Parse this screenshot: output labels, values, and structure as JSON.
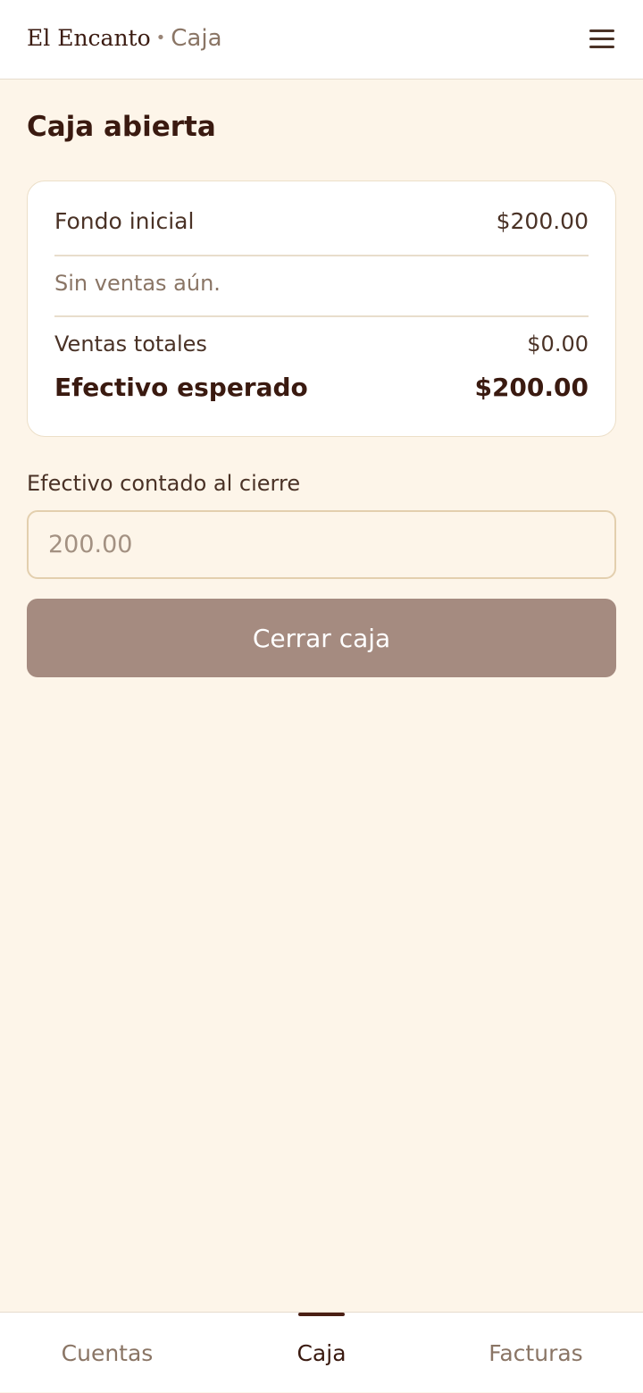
{
  "header": {
    "brand": "El Encanto",
    "separator": "•",
    "section": "Caja",
    "menu_icon": "hamburger-menu-icon"
  },
  "page": {
    "title": "Caja abierta"
  },
  "summary": {
    "opening_label": "Fondo inicial",
    "opening_value": "$200.00",
    "empty_message": "Sin ventas aún.",
    "sales_label": "Ventas totales",
    "sales_value": "$0.00",
    "expected_label": "Efectivo esperado",
    "expected_value": "$200.00"
  },
  "closing": {
    "label": "Efectivo contado al cierre",
    "placeholder": "200.00",
    "value": "",
    "button_label": "Cerrar caja"
  },
  "nav": {
    "tabs": [
      {
        "label": "Cuentas",
        "active": false
      },
      {
        "label": "Caja",
        "active": true
      },
      {
        "label": "Facturas",
        "active": false
      }
    ]
  },
  "colors": {
    "background": "#fdf5e9",
    "primary_text": "#3a1a10",
    "muted_text": "#8a7565",
    "button": "#a58b80"
  }
}
